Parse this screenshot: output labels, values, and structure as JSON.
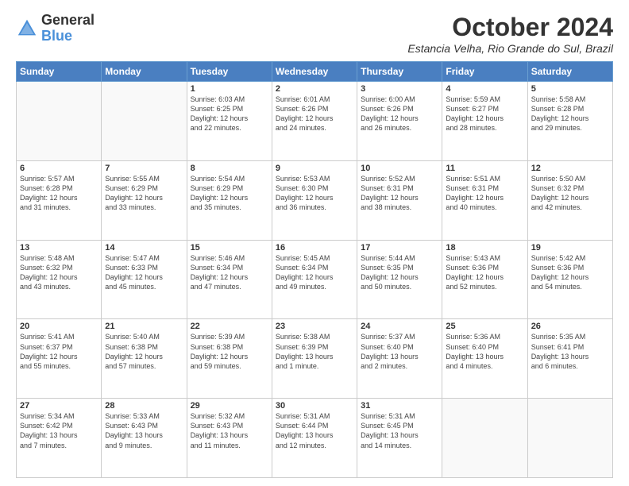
{
  "header": {
    "logo_line1": "General",
    "logo_line2": "Blue",
    "title": "October 2024",
    "location": "Estancia Velha, Rio Grande do Sul, Brazil"
  },
  "columns": [
    "Sunday",
    "Monday",
    "Tuesday",
    "Wednesday",
    "Thursday",
    "Friday",
    "Saturday"
  ],
  "weeks": [
    [
      {
        "day": "",
        "info": ""
      },
      {
        "day": "",
        "info": ""
      },
      {
        "day": "1",
        "info": "Sunrise: 6:03 AM\nSunset: 6:25 PM\nDaylight: 12 hours\nand 22 minutes."
      },
      {
        "day": "2",
        "info": "Sunrise: 6:01 AM\nSunset: 6:26 PM\nDaylight: 12 hours\nand 24 minutes."
      },
      {
        "day": "3",
        "info": "Sunrise: 6:00 AM\nSunset: 6:26 PM\nDaylight: 12 hours\nand 26 minutes."
      },
      {
        "day": "4",
        "info": "Sunrise: 5:59 AM\nSunset: 6:27 PM\nDaylight: 12 hours\nand 28 minutes."
      },
      {
        "day": "5",
        "info": "Sunrise: 5:58 AM\nSunset: 6:28 PM\nDaylight: 12 hours\nand 29 minutes."
      }
    ],
    [
      {
        "day": "6",
        "info": "Sunrise: 5:57 AM\nSunset: 6:28 PM\nDaylight: 12 hours\nand 31 minutes."
      },
      {
        "day": "7",
        "info": "Sunrise: 5:55 AM\nSunset: 6:29 PM\nDaylight: 12 hours\nand 33 minutes."
      },
      {
        "day": "8",
        "info": "Sunrise: 5:54 AM\nSunset: 6:29 PM\nDaylight: 12 hours\nand 35 minutes."
      },
      {
        "day": "9",
        "info": "Sunrise: 5:53 AM\nSunset: 6:30 PM\nDaylight: 12 hours\nand 36 minutes."
      },
      {
        "day": "10",
        "info": "Sunrise: 5:52 AM\nSunset: 6:31 PM\nDaylight: 12 hours\nand 38 minutes."
      },
      {
        "day": "11",
        "info": "Sunrise: 5:51 AM\nSunset: 6:31 PM\nDaylight: 12 hours\nand 40 minutes."
      },
      {
        "day": "12",
        "info": "Sunrise: 5:50 AM\nSunset: 6:32 PM\nDaylight: 12 hours\nand 42 minutes."
      }
    ],
    [
      {
        "day": "13",
        "info": "Sunrise: 5:48 AM\nSunset: 6:32 PM\nDaylight: 12 hours\nand 43 minutes."
      },
      {
        "day": "14",
        "info": "Sunrise: 5:47 AM\nSunset: 6:33 PM\nDaylight: 12 hours\nand 45 minutes."
      },
      {
        "day": "15",
        "info": "Sunrise: 5:46 AM\nSunset: 6:34 PM\nDaylight: 12 hours\nand 47 minutes."
      },
      {
        "day": "16",
        "info": "Sunrise: 5:45 AM\nSunset: 6:34 PM\nDaylight: 12 hours\nand 49 minutes."
      },
      {
        "day": "17",
        "info": "Sunrise: 5:44 AM\nSunset: 6:35 PM\nDaylight: 12 hours\nand 50 minutes."
      },
      {
        "day": "18",
        "info": "Sunrise: 5:43 AM\nSunset: 6:36 PM\nDaylight: 12 hours\nand 52 minutes."
      },
      {
        "day": "19",
        "info": "Sunrise: 5:42 AM\nSunset: 6:36 PM\nDaylight: 12 hours\nand 54 minutes."
      }
    ],
    [
      {
        "day": "20",
        "info": "Sunrise: 5:41 AM\nSunset: 6:37 PM\nDaylight: 12 hours\nand 55 minutes."
      },
      {
        "day": "21",
        "info": "Sunrise: 5:40 AM\nSunset: 6:38 PM\nDaylight: 12 hours\nand 57 minutes."
      },
      {
        "day": "22",
        "info": "Sunrise: 5:39 AM\nSunset: 6:38 PM\nDaylight: 12 hours\nand 59 minutes."
      },
      {
        "day": "23",
        "info": "Sunrise: 5:38 AM\nSunset: 6:39 PM\nDaylight: 13 hours\nand 1 minute."
      },
      {
        "day": "24",
        "info": "Sunrise: 5:37 AM\nSunset: 6:40 PM\nDaylight: 13 hours\nand 2 minutes."
      },
      {
        "day": "25",
        "info": "Sunrise: 5:36 AM\nSunset: 6:40 PM\nDaylight: 13 hours\nand 4 minutes."
      },
      {
        "day": "26",
        "info": "Sunrise: 5:35 AM\nSunset: 6:41 PM\nDaylight: 13 hours\nand 6 minutes."
      }
    ],
    [
      {
        "day": "27",
        "info": "Sunrise: 5:34 AM\nSunset: 6:42 PM\nDaylight: 13 hours\nand 7 minutes."
      },
      {
        "day": "28",
        "info": "Sunrise: 5:33 AM\nSunset: 6:43 PM\nDaylight: 13 hours\nand 9 minutes."
      },
      {
        "day": "29",
        "info": "Sunrise: 5:32 AM\nSunset: 6:43 PM\nDaylight: 13 hours\nand 11 minutes."
      },
      {
        "day": "30",
        "info": "Sunrise: 5:31 AM\nSunset: 6:44 PM\nDaylight: 13 hours\nand 12 minutes."
      },
      {
        "day": "31",
        "info": "Sunrise: 5:31 AM\nSunset: 6:45 PM\nDaylight: 13 hours\nand 14 minutes."
      },
      {
        "day": "",
        "info": ""
      },
      {
        "day": "",
        "info": ""
      }
    ]
  ]
}
